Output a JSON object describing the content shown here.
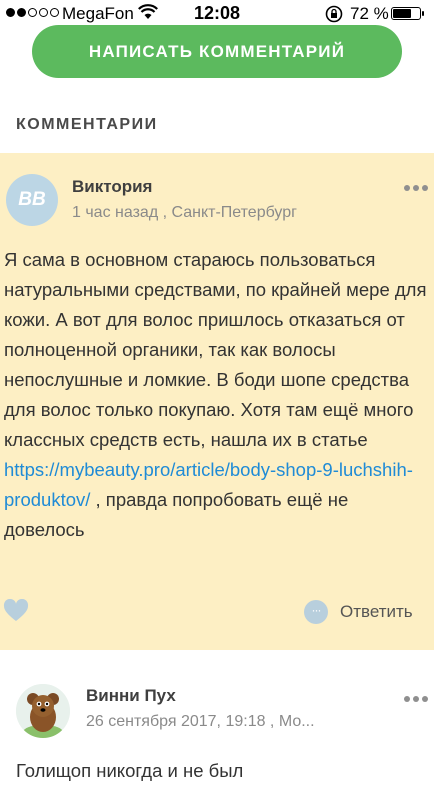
{
  "status_bar": {
    "carrier": "MegaFon",
    "time": "12:08",
    "battery": "72 %",
    "battery_level": 0.72,
    "signal_bars_filled": 2,
    "signal_bars_total": 5
  },
  "write_comment_button": "НАПИСАТЬ КОММЕНТАРИЙ",
  "section_title": "КОММЕНТАРИИ",
  "comments": [
    {
      "avatar_initials": "ВВ",
      "author": "Виктория",
      "meta": "1 час назад , Санкт-Петербург",
      "text_before_link": "Я сама в основном стараюсь пользоваться натуральными средствами, по крайней мере для кожи. А вот для волос пришлось отказаться от полноценной органики, так как волосы непослушные и ломкие. В боди шопе средства для волос только покупаю. Хотя там ещё много классных средств есть, нашла их в статье ",
      "link": "https://mybeauty.pro/article/body-shop-9-luchshih-produktov/",
      "text_after_link": " , правда попробовать ещё не довелось",
      "reply_label": "Ответить"
    },
    {
      "author": "Винни Пух",
      "meta": "26 сентября 2017, 19:18 , Мо...",
      "text": "Голищоп никогда и не был"
    }
  ],
  "colors": {
    "accent_green": "#5cba5e",
    "highlight_bg": "#fdefc4",
    "link_blue": "#1f8bd6"
  }
}
